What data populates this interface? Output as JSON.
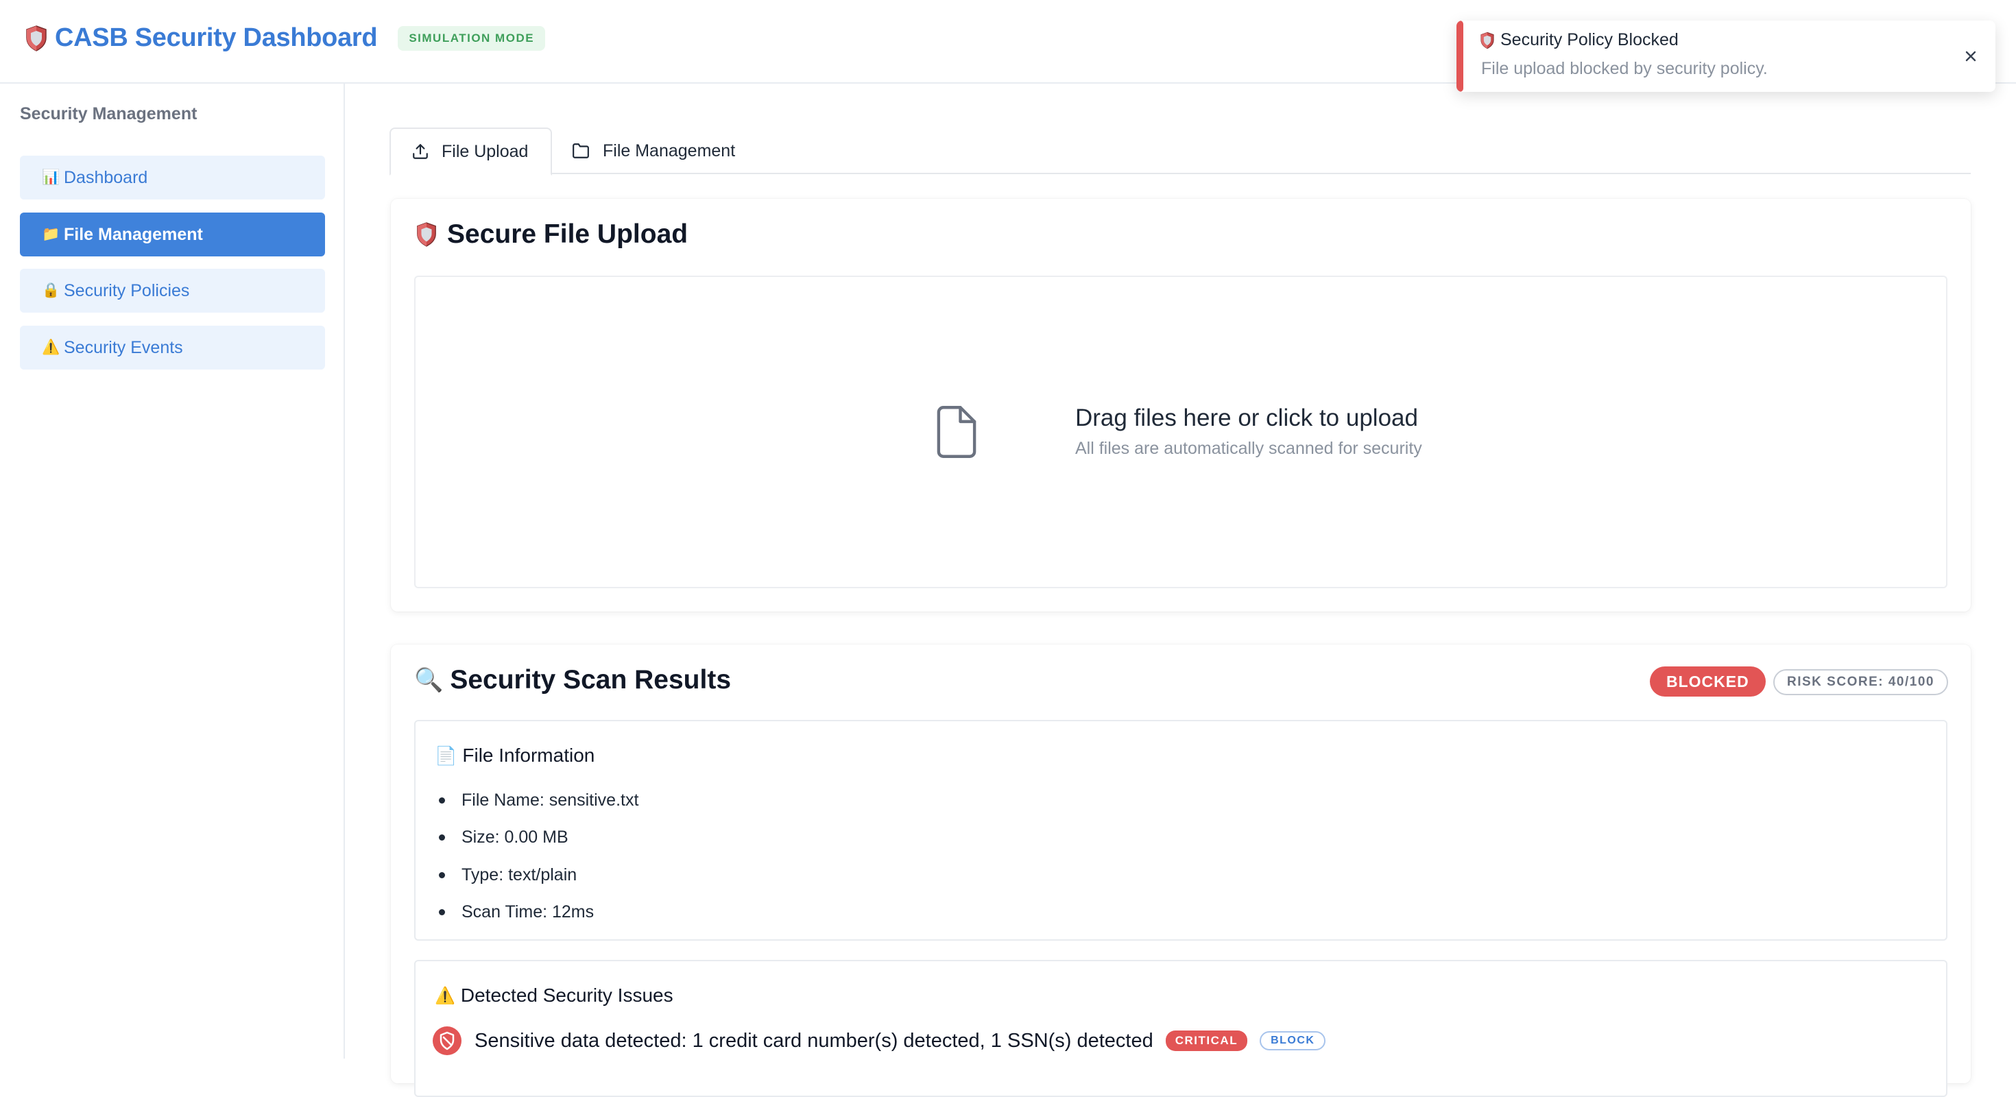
{
  "app": {
    "title": "CASB Security Dashboard",
    "mode_badge": "SIMULATION MODE",
    "brand_icon": "shield-icon"
  },
  "sidebar": {
    "heading": "Security Management",
    "items": [
      {
        "label": "Dashboard",
        "icon": "📊",
        "active": false
      },
      {
        "label": "File Management",
        "icon": "📁",
        "active": true
      },
      {
        "label": "Security Policies",
        "icon": "🔒",
        "active": false
      },
      {
        "label": "Security Events",
        "icon": "⚠️",
        "active": false
      }
    ]
  },
  "tabs": [
    {
      "label": "File Upload",
      "icon": "upload-icon",
      "active": true
    },
    {
      "label": "File Management",
      "icon": "folder-icon",
      "active": false
    }
  ],
  "upload": {
    "title": "Secure File Upload",
    "dropzone_title": "Drag files here or click to upload",
    "dropzone_subtitle": "All files are automatically scanned for security"
  },
  "results": {
    "title": "Security Scan Results",
    "title_icon": "🔍",
    "status": "BLOCKED",
    "risk_score": "RISK SCORE: 40/100",
    "file_info": {
      "title": "File Information",
      "icon": "📄",
      "items": [
        "File Name: sensitive.txt",
        "Size: 0.00 MB",
        "Type: text/plain",
        "Scan Time: 12ms"
      ]
    },
    "issues": {
      "title": "Detected Security Issues",
      "icon": "⚠️",
      "items": [
        {
          "text": "Sensitive data detected: 1 credit card number(s) detected, 1 SSN(s) detected",
          "severity": "CRITICAL",
          "action": "BLOCK"
        }
      ]
    }
  },
  "toast": {
    "title": "Security Policy Blocked",
    "message": "File upload blocked by security policy.",
    "accent_color": "#e25555"
  },
  "colors": {
    "brand": "#3a7bd5",
    "active_nav": "#3f82db",
    "nav_bg": "#ebf3fd",
    "danger": "#e25555",
    "success_text": "#3f9f5b"
  }
}
